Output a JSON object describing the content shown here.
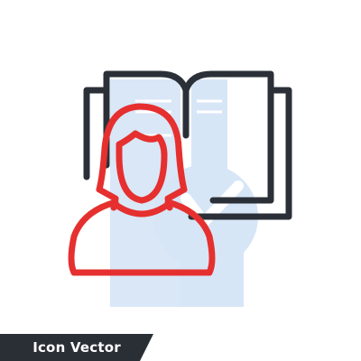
{
  "banner": {
    "label": "Icon Vector"
  },
  "icon": {
    "name": "reader-with-open-book",
    "colors": {
      "outline": "#2b3038",
      "accent": "#e5302f",
      "fill": "#d7e6f7"
    }
  }
}
